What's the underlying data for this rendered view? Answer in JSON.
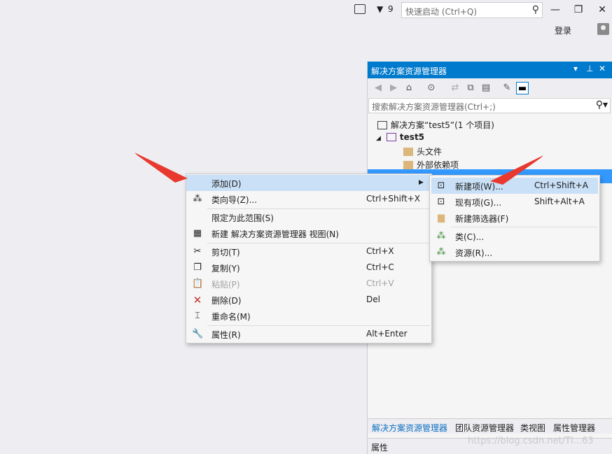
{
  "titlebar": {
    "notification_count": "9",
    "quick_launch_placeholder": "快速启动 (Ctrl+Q)",
    "sign_in": "登录",
    "minimize": "—",
    "restore": "❐",
    "close": "✕"
  },
  "solution_explorer": {
    "title": "解决方案资源管理器",
    "title_buttons": [
      "▾",
      "⊥",
      "✕"
    ],
    "search_placeholder": "搜索解决方案资源管理器(Ctrl+;)",
    "tree": {
      "solution": "解决方案“test5”(1 个项目)",
      "project": "test5",
      "headers": "头文件",
      "external": "外部依赖项"
    },
    "tabs": [
      "解决方案资源管理器",
      "团队资源管理器",
      "类视图",
      "属性管理器"
    ],
    "properties_label": "属性"
  },
  "context_menu": {
    "items": [
      {
        "label": "添加(D)",
        "shortcut": "",
        "icon": "none"
      },
      {
        "label": "类向导(Z)...",
        "shortcut": "Ctrl+Shift+X",
        "icon": "class-wizard-icon"
      },
      {
        "label": "限定为此范围(S)",
        "shortcut": "",
        "icon": "none"
      },
      {
        "label": "新建 解决方案资源管理器 视图(N)",
        "shortcut": "",
        "icon": "new-view-icon"
      },
      {
        "label": "剪切(T)",
        "shortcut": "Ctrl+X",
        "icon": "scissors-icon"
      },
      {
        "label": "复制(Y)",
        "shortcut": "Ctrl+C",
        "icon": "copy-icon"
      },
      {
        "label": "粘贴(P)",
        "shortcut": "Ctrl+V",
        "icon": "paste-icon"
      },
      {
        "label": "删除(D)",
        "shortcut": "Del",
        "icon": "delete-icon"
      },
      {
        "label": "重命名(M)",
        "shortcut": "",
        "icon": "rename-icon"
      },
      {
        "label": "属性(R)",
        "shortcut": "Alt+Enter",
        "icon": "wrench-icon"
      }
    ]
  },
  "submenu": {
    "items": [
      {
        "label": "新建项(W)...",
        "shortcut": "Ctrl+Shift+A"
      },
      {
        "label": "现有项(G)...",
        "shortcut": "Shift+Alt+A"
      },
      {
        "label": "新建筛选器(F)",
        "shortcut": ""
      },
      {
        "label": "类(C)...",
        "shortcut": ""
      },
      {
        "label": "资源(R)...",
        "shortcut": ""
      }
    ]
  },
  "watermark": "https://blog.csdn.net/Tl...63",
  "colors": {
    "accent": "#007acc",
    "highlight": "#c9e0f7",
    "arrow": "#e8392f"
  }
}
